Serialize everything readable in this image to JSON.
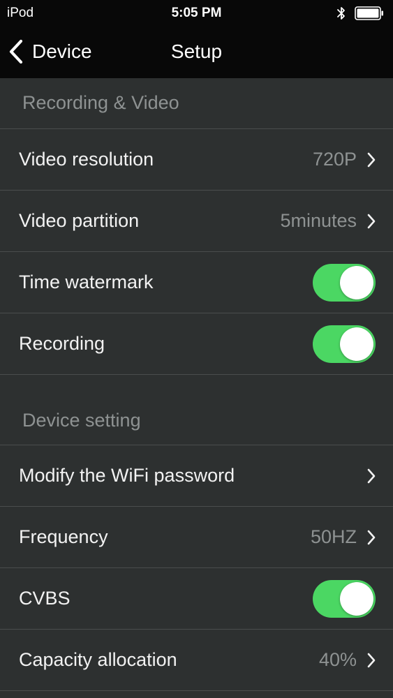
{
  "status_bar": {
    "carrier": "iPod",
    "time": "5:05 PM",
    "bluetooth_icon": "bluetooth-icon",
    "battery_icon": "battery-full-icon"
  },
  "nav": {
    "back_label": "Device",
    "back_icon": "chevron-left-icon",
    "title": "Setup"
  },
  "colors": {
    "toggle_on": "#4bd763",
    "background": "#2d3030",
    "header_text": "#8e9292"
  },
  "sections": [
    {
      "header": "Recording & Video",
      "rows": [
        {
          "label": "Video resolution",
          "value": "720P",
          "type": "disclosure"
        },
        {
          "label": "Video partition",
          "value": "5minutes",
          "type": "disclosure"
        },
        {
          "label": "Time watermark",
          "type": "toggle",
          "on": true
        },
        {
          "label": "Recording",
          "type": "toggle",
          "on": true
        }
      ]
    },
    {
      "header": "Device setting",
      "rows": [
        {
          "label": "Modify the WiFi password",
          "value": "",
          "type": "disclosure"
        },
        {
          "label": "Frequency",
          "value": "50HZ",
          "type": "disclosure"
        },
        {
          "label": "CVBS",
          "type": "toggle",
          "on": true
        },
        {
          "label": "Capacity allocation",
          "value": "40%",
          "type": "disclosure"
        }
      ]
    }
  ]
}
